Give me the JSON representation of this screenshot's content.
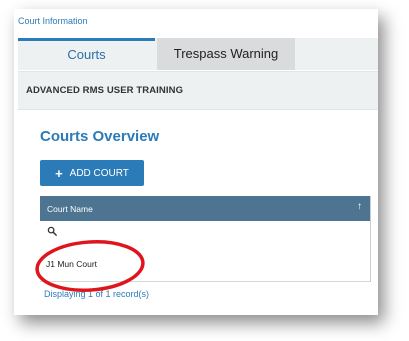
{
  "breadcrumb": "Court Information",
  "tabs": [
    {
      "label": "Courts",
      "active": true
    },
    {
      "label": "Trespass Warning",
      "active": false
    }
  ],
  "section_title": "ADVANCED RMS USER TRAINING",
  "overview_title": "Courts Overview",
  "add_button": {
    "icon": "plus-icon",
    "label": "ADD COURT"
  },
  "grid": {
    "columns": [
      "Court Name"
    ],
    "sort_icon": "sort-up-icon",
    "filter_icon": "search-icon",
    "rows": [
      [
        "J1 Mun Court"
      ]
    ],
    "footer": "Displaying 1 of 1 record(s)"
  },
  "annotation": {
    "shape": "red-ellipse",
    "color": "#e0141c"
  },
  "colors": {
    "accent": "#2b7bb9",
    "header_bg": "#4d7591"
  }
}
